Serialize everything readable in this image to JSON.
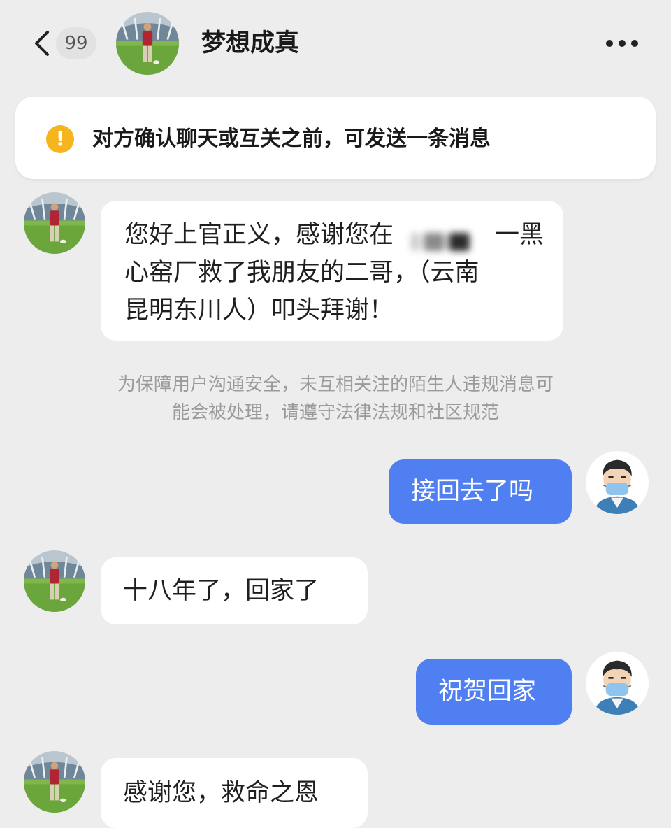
{
  "header": {
    "back_icon": "chevron-left-icon",
    "unread_badge": "99",
    "contact_name": "梦想成真",
    "more_icon": "more-horizontal-icon"
  },
  "notice": {
    "icon": "warning-icon",
    "icon_glyph": "!",
    "text": "对方确认聊天或互关之前，可发送一条消息",
    "color": "#f6b51d"
  },
  "messages": [
    {
      "sender": "contact",
      "lines": [
        "您好上官正义，感谢您在",
        "一黑",
        "心窑厂救了我朋友的二哥，（云南",
        "昆明东川人）叩头拜谢！"
      ]
    },
    {
      "sender": "self",
      "text": "接回去了吗"
    },
    {
      "sender": "contact",
      "text": "十八年了，回家了"
    },
    {
      "sender": "self",
      "text": "祝贺回家"
    },
    {
      "sender": "contact",
      "text": "感谢您，救命之恩"
    }
  ],
  "system_notice": {
    "line1": "为保障用户沟通安全，未互相关注的陌生人违规消息可",
    "line2": "能会被处理，请遵守法律法规和社区规范"
  },
  "colors": {
    "background": "#ededed",
    "incoming_bubble": "#ffffff",
    "outgoing_bubble": "#4f7ff1",
    "system_text": "#9a9a9a"
  }
}
